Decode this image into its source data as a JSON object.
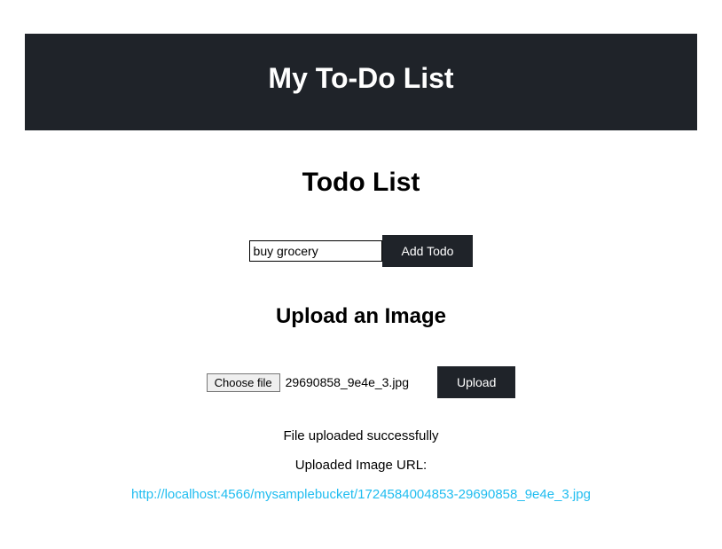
{
  "header": {
    "title": "My To-Do List"
  },
  "todo": {
    "section_title": "Todo List",
    "input_value": "buy grocery",
    "add_button_label": "Add Todo"
  },
  "upload": {
    "section_title": "Upload an Image",
    "choose_file_label": "Choose file",
    "selected_file_name": "29690858_9e4e_3.jpg",
    "upload_button_label": "Upload",
    "status_message": "File uploaded successfully",
    "url_label": "Uploaded Image URL:",
    "uploaded_url": "http://localhost:4566/mysamplebucket/1724584004853-29690858_9e4e_3.jpg"
  }
}
